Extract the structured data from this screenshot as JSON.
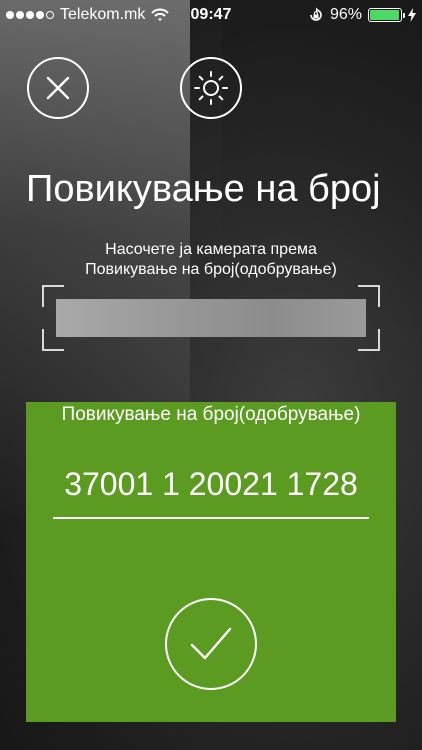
{
  "status_bar": {
    "carrier": "Telekom.mk",
    "time": "09:47",
    "battery_percent": "96%",
    "battery_level": 0.96,
    "signal_bars": 4,
    "signal_total": 5,
    "icons": [
      "wifi-icon",
      "orientation-lock-icon",
      "battery-icon",
      "charging-icon"
    ]
  },
  "toolbar": {
    "close_icon": "close-icon",
    "brightness_icon": "brightness-icon"
  },
  "header": {
    "title": "Повикување на број"
  },
  "instruction": {
    "line1": "Насочете ја камерата према",
    "line2": "Повикување на број(одобрување)"
  },
  "form": {
    "label": "Повикување на број(одобрување)",
    "value": "37001 1 20021 1728",
    "confirm_icon": "checkmark-icon"
  },
  "colors": {
    "panel": "#5c9b22",
    "battery": "#4cd964",
    "text": "#ffffff"
  }
}
